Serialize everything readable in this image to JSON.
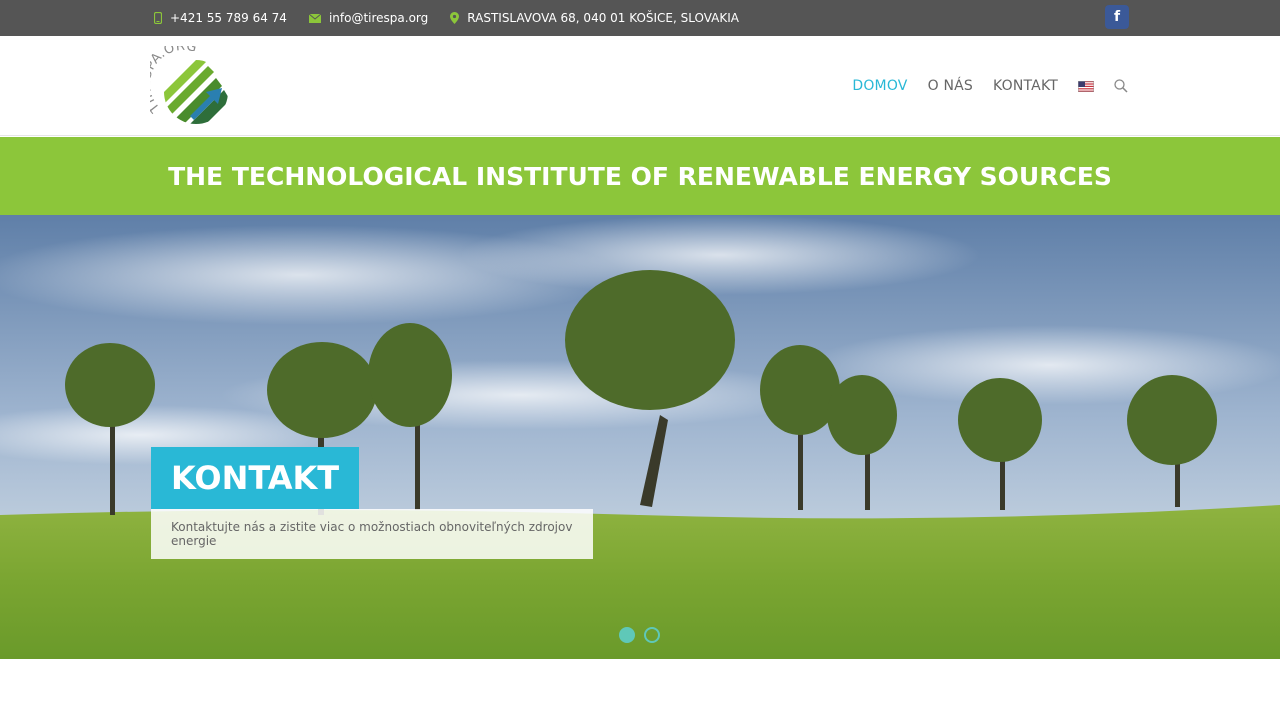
{
  "topbar": {
    "phone": "+421 55 789 64 74",
    "email": "info@tirespa.org",
    "address": "RASTISLAVOVA 68, 040 01 KOŠICE, SLOVAKIA",
    "social_icon": "facebook-icon",
    "social_label": "f"
  },
  "header": {
    "logo_text": "TIRESPA.ORG",
    "nav": [
      {
        "label": "DOMOV",
        "active": true
      },
      {
        "label": "O NÁS",
        "active": false
      },
      {
        "label": "KONTAKT",
        "active": false
      }
    ],
    "language_icon": "us-flag-icon",
    "search_icon": "search-icon"
  },
  "banner": {
    "title": "THE TECHNOLOGICAL INSTITUTE OF RENEWABLE ENERGY SOURCES"
  },
  "slider": {
    "slide_title": "KONTAKT",
    "slide_caption": "Kontaktujte nás a zistite viac o možnostiach obnoviteľných zdrojov energie",
    "dots": [
      true,
      false
    ]
  },
  "colors": {
    "accent_blue": "#29b8d6",
    "accent_green": "#8cc63a",
    "topbar_bg": "#555555",
    "dot_teal": "#5fc8b8"
  }
}
